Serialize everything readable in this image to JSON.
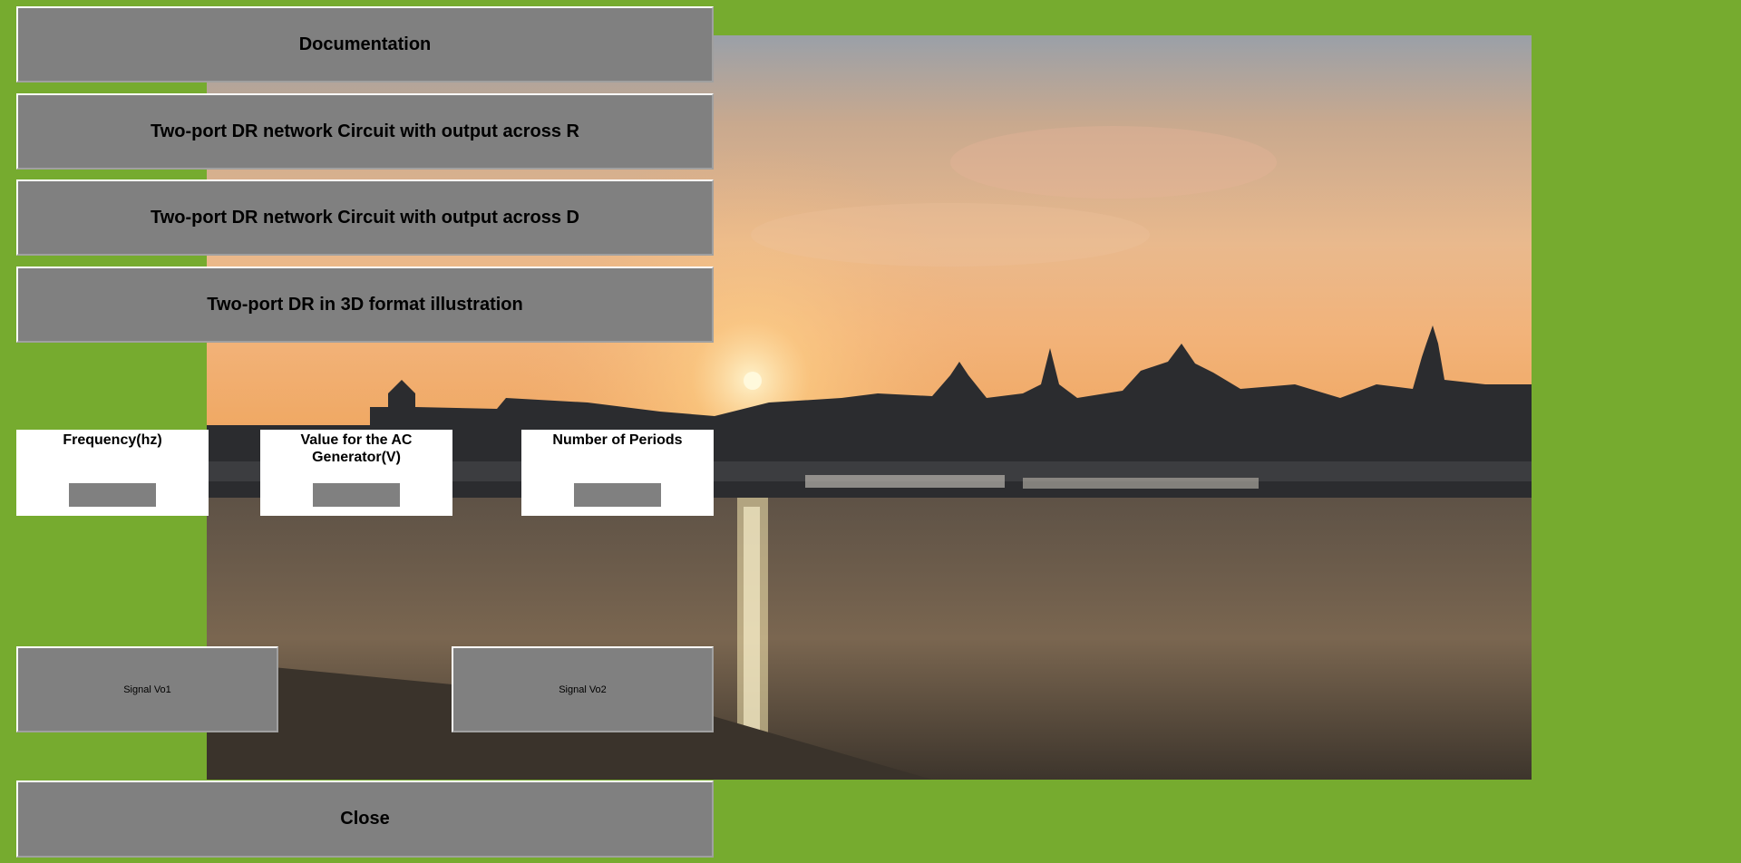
{
  "buttons": {
    "documentation": "Documentation",
    "output_r": "Two-port DR network Circuit with output across R",
    "output_d": "Two-port DR network Circuit with output across D",
    "illustration_3d": "Two-port DR in 3D format illustration",
    "signal_vo1": "Signal Vo1",
    "signal_vo2": "Signal Vo2",
    "close": "Close"
  },
  "inputs": {
    "frequency": {
      "label": "Frequency(hz)",
      "value": ""
    },
    "ac_generator": {
      "label": "Value for the AC Generator(V)",
      "value": ""
    },
    "periods": {
      "label": "Number of Periods",
      "value": ""
    }
  },
  "colors": {
    "background": "#76ab2f",
    "button": "#808080",
    "panel": "#ffffff"
  },
  "image": {
    "icon": "sunset-river-photo"
  }
}
